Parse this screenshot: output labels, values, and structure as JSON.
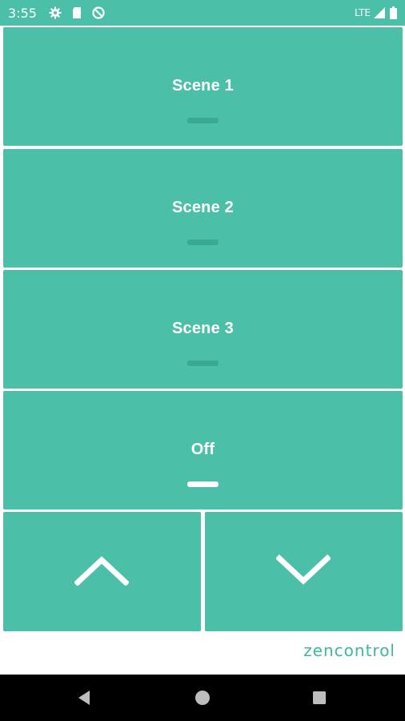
{
  "status_bar": {
    "time": "3:55",
    "network": "LTE",
    "icons": [
      "settings-icon",
      "sd-card-icon",
      "data-saver-icon",
      "signal-icon",
      "battery-icon"
    ]
  },
  "scenes": [
    {
      "label": "Scene 1",
      "active": false
    },
    {
      "label": "Scene 2",
      "active": false
    },
    {
      "label": "Scene 3",
      "active": false
    },
    {
      "label": "Off",
      "active": true
    }
  ],
  "controls": {
    "up_icon": "chevron-up-icon",
    "down_icon": "chevron-down-icon"
  },
  "brand": {
    "name": "zencontrol"
  },
  "nav_bar": {
    "icons": [
      "back-icon",
      "home-icon",
      "recents-icon"
    ]
  },
  "colors": {
    "accent": "#4bbfa8",
    "indicator_inactive": "#3aa892",
    "indicator_active": "#ffffff",
    "brand": "#3fb69f"
  }
}
